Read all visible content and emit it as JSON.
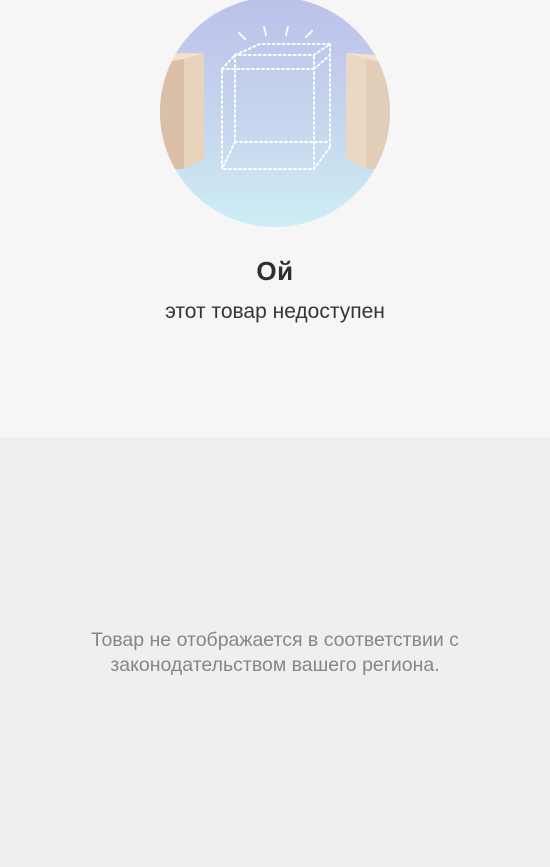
{
  "unavailable": {
    "illustration_icon": "empty-box-between-doors-icon",
    "title": "Ой",
    "subtitle": "этот товар недоступен"
  },
  "legal_notice": {
    "text": "Товар не отображается в соответствии с законодательством вашего региона."
  },
  "colors": {
    "top_background": "#f6f6f6",
    "bottom_background": "#efefef",
    "title_text": "#2d2f36",
    "notice_text": "#85868a"
  }
}
